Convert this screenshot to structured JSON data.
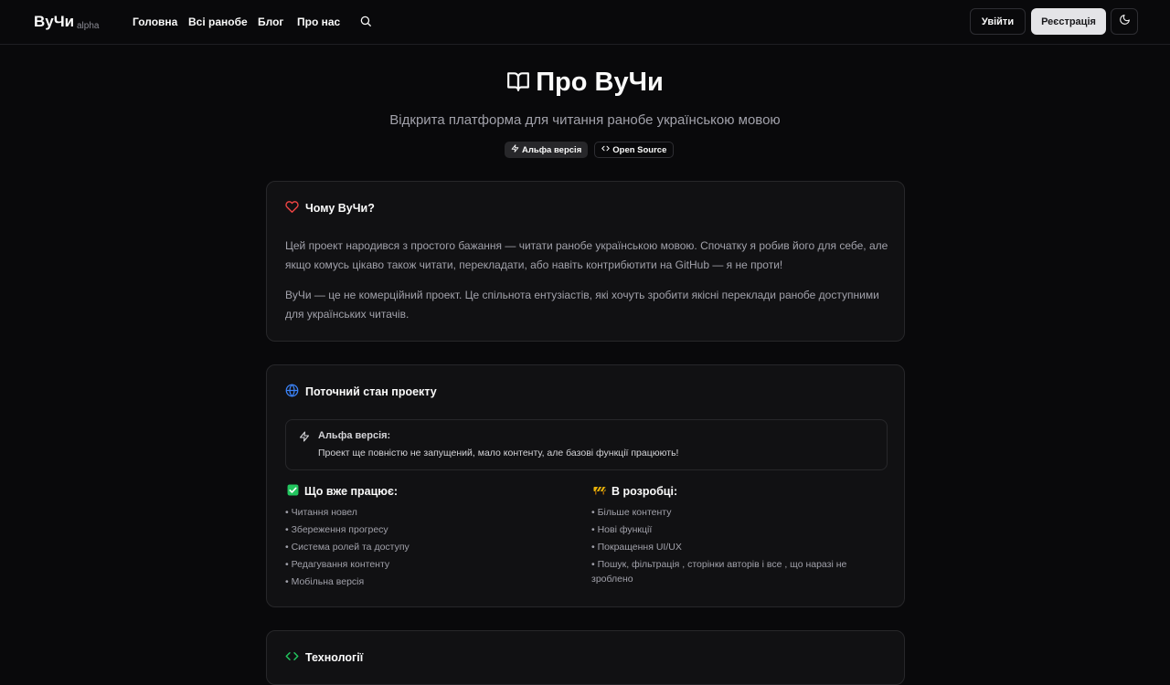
{
  "header": {
    "logo": "ВуЧи",
    "logo_tag": "alpha",
    "nav": [
      "Головна",
      "Всі ранобе",
      "Блог",
      "Про нас"
    ],
    "login_label": "Увійти",
    "register_label": "Реєстрація"
  },
  "hero": {
    "title": "Про ВуЧи",
    "subtitle": "Відкрита платформа для читання ранобе українською мовою",
    "badges": [
      "Альфа версія",
      "Open Source"
    ]
  },
  "why": {
    "title": "Чому ВуЧи?",
    "p1": "Цей проект народився з простого бажання — читати ранобе українською мовою. Спочатку я робив його для себе, але якщо комусь цікаво також читати, перекладати, або навіть контрибютити на GitHub — я не проти!",
    "p2": "ВуЧи — це не комерційний проект. Це спільнота ентузіастів, які хочуть зробити якісні переклади ранобе доступними для українських читачів."
  },
  "status": {
    "title": "Поточний стан проекту",
    "alert_title": "Альфа версія:",
    "alert_desc": "Проект ще повністю не запущений, мало контенту, але базові функції працюють!",
    "works_title": "Що вже працює:",
    "works": [
      "• Читання новел",
      "• Збереження прогресу",
      "• Система ролей та доступу",
      "• Редагування контенту",
      "• Мобільна версія"
    ],
    "dev_title": "В розробці:",
    "dev": [
      "• Більше контенту",
      "• Нові функції",
      "• Покращення UI/UX",
      "• Пошук, фільтрація , сторінки авторів і все , що наразі не зроблено"
    ]
  },
  "tech": {
    "title": "Технології"
  },
  "colors": {
    "background": "#09090b",
    "card": "#111113",
    "heart": "#ef4444",
    "globe": "#3b82f6",
    "check": "#22c55e",
    "construction": "#eab308",
    "code": "#22c55e"
  }
}
